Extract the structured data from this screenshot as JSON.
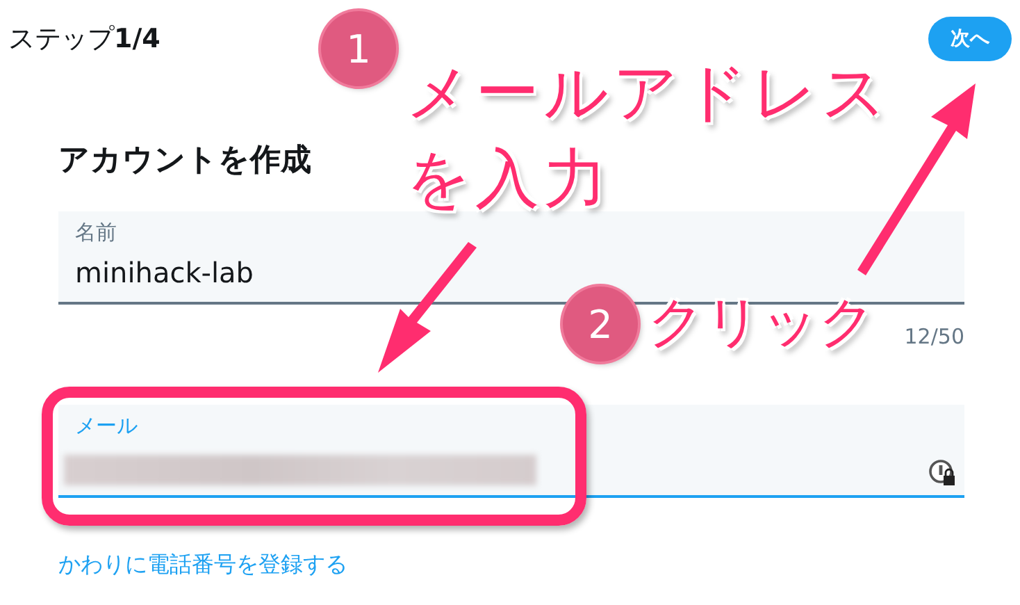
{
  "header": {
    "step": "ステップ",
    "step_count": "1/4",
    "next_button": "次へ"
  },
  "title": "アカウントを作成",
  "fields": [
    {
      "kind": "text",
      "label": "名前",
      "value": "minihack-lab",
      "counter": "12/50",
      "focused": false
    },
    {
      "kind": "blurred",
      "label": "メール",
      "focused": true
    }
  ],
  "phone_link": "かわりに電話番号を登録する",
  "annotations": [
    {
      "kind": "badge",
      "text": "1"
    },
    {
      "kind": "label",
      "text": "メールアドレス"
    },
    {
      "kind": "label",
      "text": "を入力"
    },
    {
      "kind": "badge",
      "text": "2"
    },
    {
      "kind": "label",
      "text": "クリック"
    }
  ]
}
